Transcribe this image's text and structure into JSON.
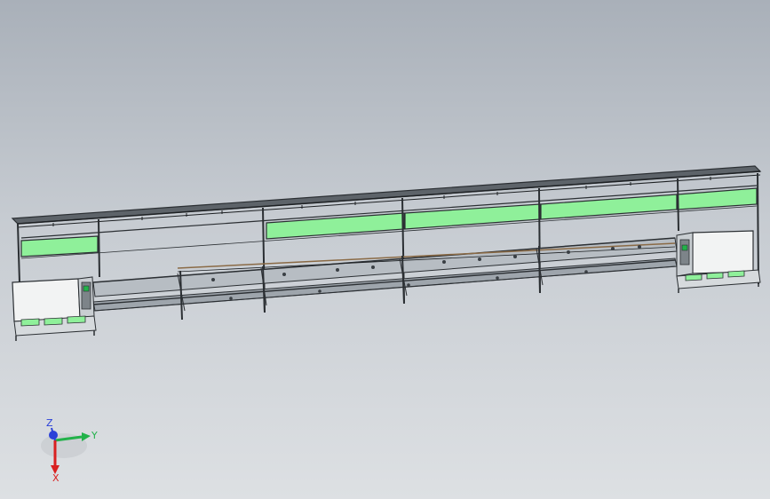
{
  "viewport": {
    "colors": {
      "background_top": "#a9b0b9",
      "background_bottom": "#dde0e3",
      "frame": "#2b2f33",
      "panel_green": "#8ff09a",
      "cabinet": "#f2f3f3",
      "conveyor_roller": "#8a6a45"
    }
  },
  "triad": {
    "x_label": "X",
    "y_label": "Y",
    "z_label": "Z",
    "colors": {
      "x": "#d92020",
      "y": "#22b24a",
      "z": "#2a40d8"
    }
  }
}
